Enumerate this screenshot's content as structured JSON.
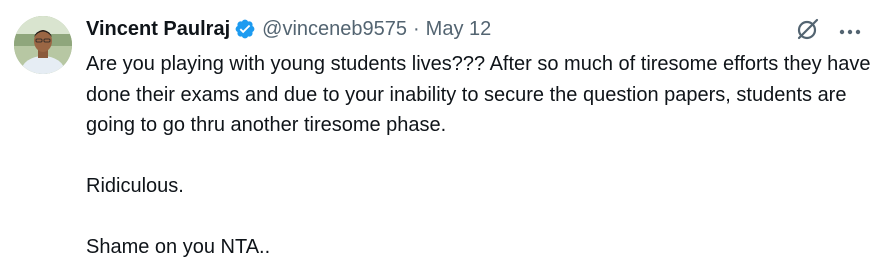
{
  "tweet": {
    "author": {
      "display_name": "Vincent Paulraj",
      "handle": "@vinceneb9575",
      "verified_icon": "verified-badge-icon",
      "avatar_icon": "user-avatar"
    },
    "separator": "·",
    "date": "May 12",
    "actions": {
      "grok_icon": "grok-icon",
      "more_icon": "more-horizontal-icon"
    },
    "paragraphs": [
      "Are you playing with young students lives??? After so much of tiresome efforts they have done their exams and due to your inability to secure the question papers, students are going to go thru another tiresome phase.",
      "Ridiculous.",
      "Shame on you NTA.."
    ]
  },
  "colors": {
    "verified_blue": "#1d9bf0",
    "text_primary": "#0f1419",
    "text_secondary": "#536471"
  }
}
